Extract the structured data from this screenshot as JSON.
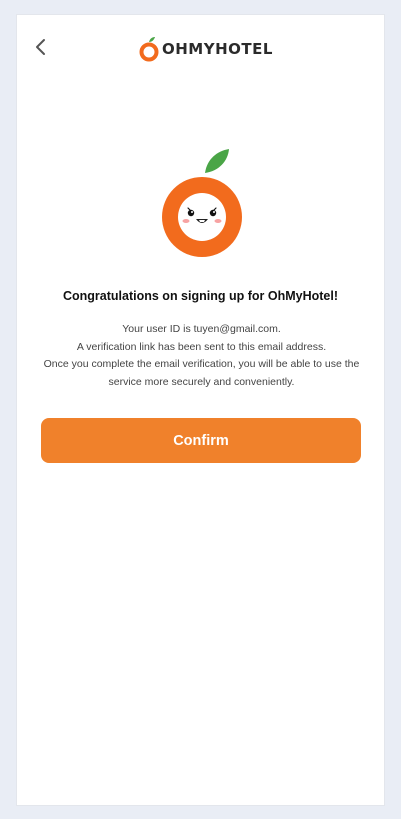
{
  "header": {
    "back_icon": "chevron-left-icon",
    "logo_text": "OHMYHOTEL"
  },
  "mascot": {
    "icon": "orange-mascot-icon"
  },
  "content": {
    "title": "Congratulations on signing up for OhMyHotel!",
    "message_lines": [
      "Your user ID is tuyen@gmail.com.",
      "A verification link has been sent to this email address.",
      "Once you complete the email verification, you will be able to use the",
      "service more securely and conveniently."
    ]
  },
  "actions": {
    "confirm_label": "Confirm"
  },
  "colors": {
    "brand_orange": "#f0812b",
    "mascot_orange": "#f26b1d",
    "leaf_green": "#4aa547",
    "background": "#e9edf5"
  }
}
